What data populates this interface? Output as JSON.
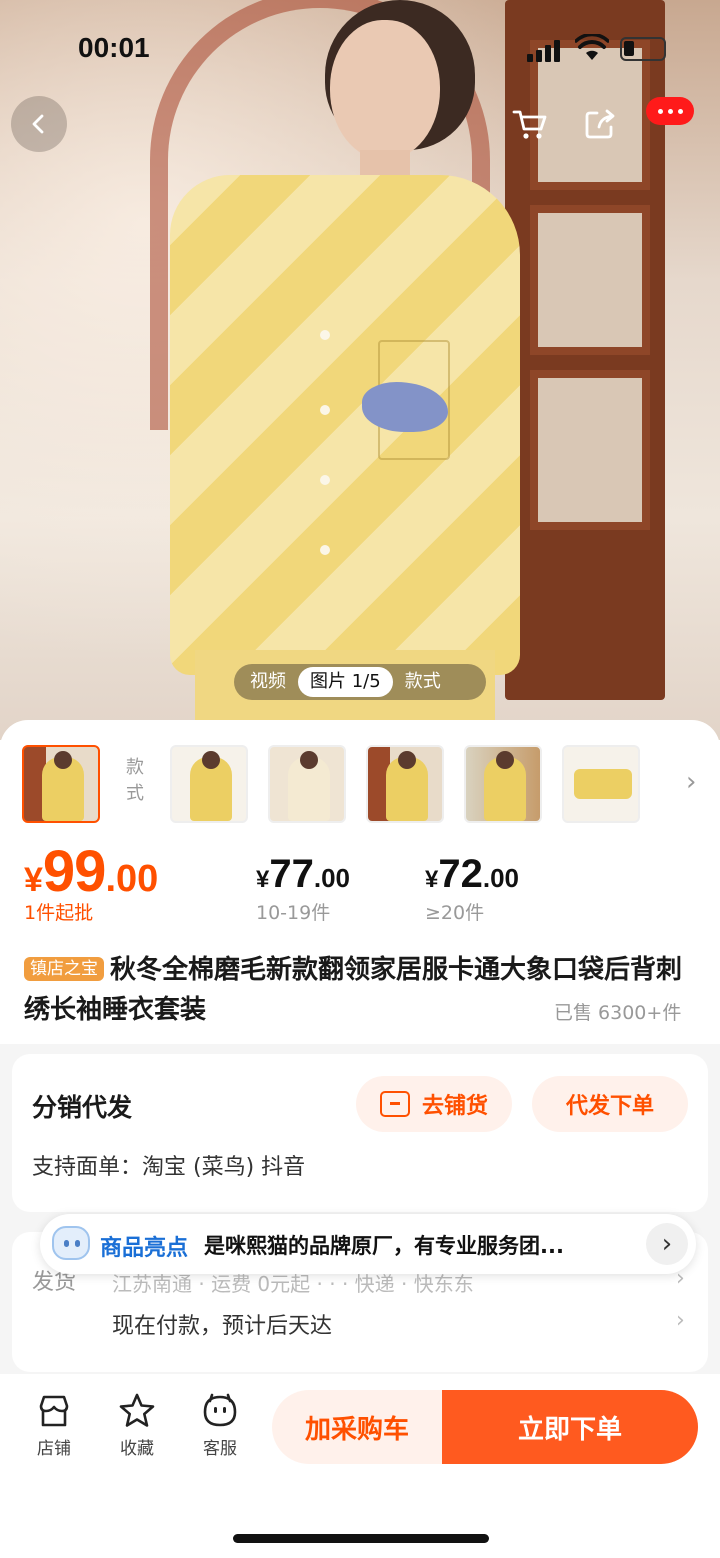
{
  "status_bar": {
    "time": "00:01"
  },
  "gallery": {
    "tabs": [
      "视频",
      "图片 1/5",
      "款式"
    ],
    "active_tab": 1,
    "style_label": "款式"
  },
  "prices": {
    "main": {
      "symbol": "¥",
      "integer": "99",
      "decimal": ".00",
      "label": "1件起批"
    },
    "tiers": [
      {
        "symbol": "¥",
        "integer": "77",
        "decimal": ".00",
        "label": "10-19件"
      },
      {
        "symbol": "¥",
        "integer": "72",
        "decimal": ".00",
        "label": "≥20件"
      }
    ]
  },
  "product": {
    "badge": "镇店之宝",
    "title": "秋冬全棉磨毛新款翻领家居服卡通大象口袋后背刺绣长袖睡衣套装",
    "sold": "已售 6300+件"
  },
  "distribution": {
    "title": "分销代发",
    "stock_button": "去铺货",
    "order_button": "代发下单",
    "support_text": "支持面单：淘宝 (菜鸟) 抖音"
  },
  "highlight": {
    "key": "商品亮点",
    "text": "是咪熙猫的品牌原厂，有专业服务团..."
  },
  "shipping": {
    "label": "发货",
    "partial_line": "江苏南通 · 运费 0元起 · · · 快递 · 快东东",
    "eta": "现在付款，预计后天达"
  },
  "bottom_bar": {
    "shop": "店铺",
    "favorite": "收藏",
    "service": "客服",
    "add_cart": "加采购车",
    "buy_now": "立即下单"
  },
  "colors": {
    "accent": "#ff5000",
    "accent_light": "#fff1eb",
    "link_blue": "#1a6fd6"
  }
}
